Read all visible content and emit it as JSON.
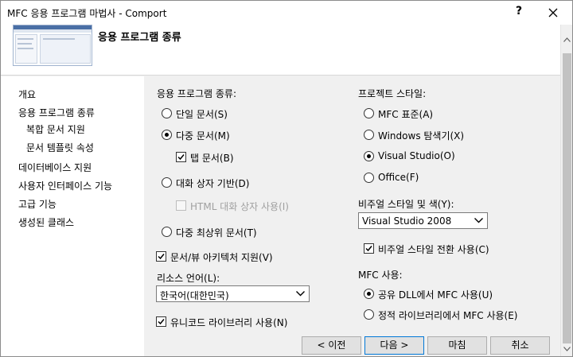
{
  "window": {
    "title": "MFC 응용 프로그램 마법사 - Comport",
    "help_glyph": "?",
    "header_title": "응용 프로그램 종류"
  },
  "nav": {
    "items": [
      {
        "label": "개요"
      },
      {
        "label": "응용 프로그램 종류"
      },
      {
        "label": "복합 문서 지원"
      },
      {
        "label": "문서 템플릿 속성"
      },
      {
        "label": "데이터베이스 지원"
      },
      {
        "label": "사용자 인터페이스 기능"
      },
      {
        "label": "고급 기능"
      },
      {
        "label": "생성된 클래스"
      }
    ]
  },
  "app_type": {
    "heading": "응용 프로그램 종류:",
    "single": "단일 문서(S)",
    "multi": "다중 문서(M)",
    "tabbed": "탭 문서(B)",
    "dialog": "대화 상자 기반(D)",
    "html_dialog": "HTML 대화 상자 사용(I)",
    "multi_top": "다중 최상위 문서(T)",
    "doc_view": "문서/뷰 아키텍처 지원(V)",
    "resource_lang_label": "리소스 언어(L):",
    "resource_lang_value": "한국어(대한민국)",
    "unicode": "유니코드 라이브러리 사용(N)"
  },
  "project_style": {
    "heading": "프로젝트 스타일:",
    "mfc_standard": "MFC 표준(A)",
    "windows_explorer": "Windows 탐색기(X)",
    "visual_studio": "Visual Studio(O)",
    "office": "Office(F)",
    "visual_style_label": "비주얼 스타일 및 색(Y):",
    "visual_style_value": "Visual Studio 2008",
    "style_switch": "비주얼 스타일 전환 사용(C)",
    "mfc_use_label": "MFC 사용:",
    "shared_dll": "공유 DLL에서 MFC 사용(U)",
    "static_lib": "정적 라이브러리에서 MFC 사용(E)"
  },
  "buttons": {
    "prev": "< 이전",
    "next": "다음 >",
    "finish": "마침",
    "cancel": "취소"
  }
}
